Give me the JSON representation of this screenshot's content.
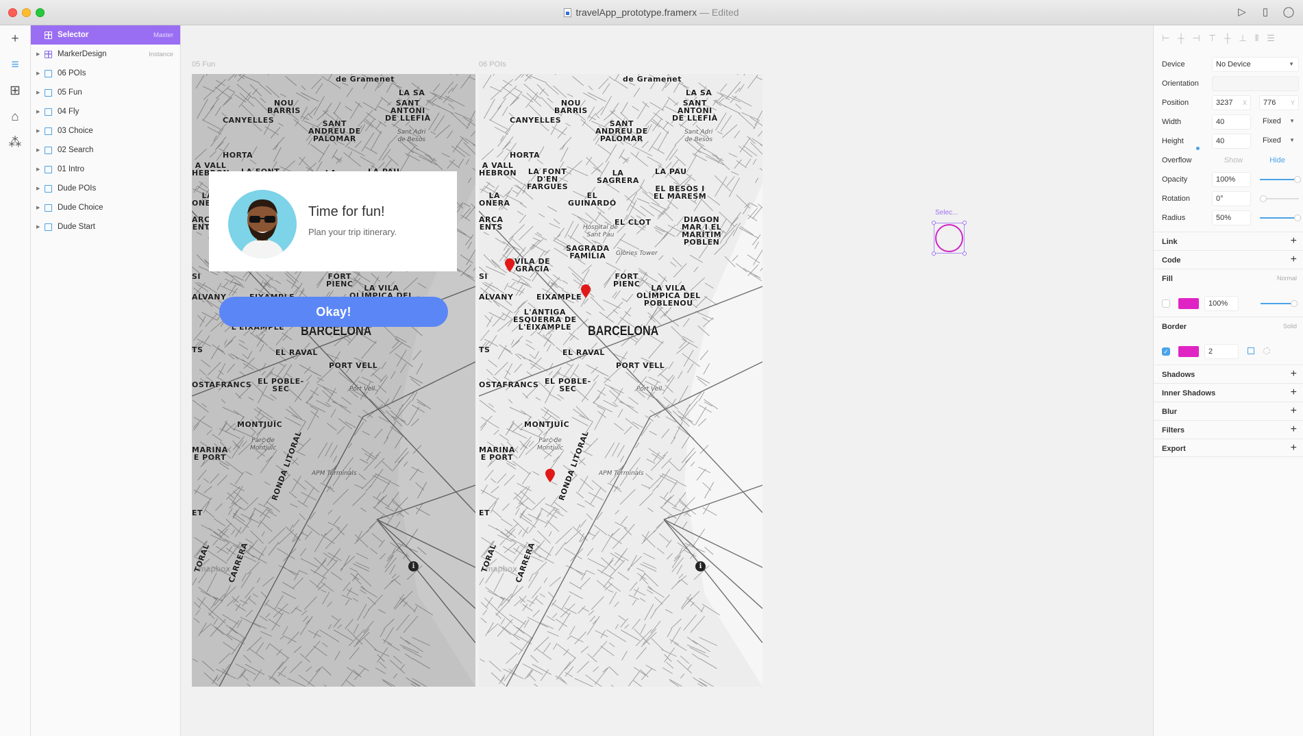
{
  "window": {
    "filename": "travelApp_prototype.framerx",
    "status": "— Edited"
  },
  "toolbar_right": {
    "icons": [
      "play-icon",
      "device-icon",
      "comment-icon"
    ]
  },
  "rail": {
    "icons": [
      "insert-icon",
      "layers-icon",
      "components-icon",
      "store-icon",
      "packages-icon"
    ]
  },
  "layers": [
    {
      "name": "Selector",
      "tag": "Master",
      "type": "component",
      "selected": true
    },
    {
      "name": "MarkerDesign",
      "tag": "Instance",
      "type": "component",
      "selected": false
    },
    {
      "name": "06 POIs",
      "tag": "",
      "type": "frame",
      "selected": false
    },
    {
      "name": "05 Fun",
      "tag": "",
      "type": "frame",
      "selected": false
    },
    {
      "name": "04 Fly",
      "tag": "",
      "type": "frame",
      "selected": false
    },
    {
      "name": "03 Choice",
      "tag": "",
      "type": "frame",
      "selected": false
    },
    {
      "name": "02 Search",
      "tag": "",
      "type": "frame",
      "selected": false
    },
    {
      "name": "01 Intro",
      "tag": "",
      "type": "frame",
      "selected": false
    },
    {
      "name": "Dude POIs",
      "tag": "",
      "type": "frame",
      "selected": false
    },
    {
      "name": "Dude Choice",
      "tag": "",
      "type": "frame",
      "selected": false
    },
    {
      "name": "Dude Start",
      "tag": "",
      "type": "frame",
      "selected": false
    }
  ],
  "canvas": {
    "frame1_label": "05 Fun",
    "frame2_label": "06 POIs",
    "selector_label": "Selec...",
    "map_labels": {
      "gramenet": "de Gramenet",
      "la_sa": "LA SA",
      "nou_barris": "NOU\nBARRIS",
      "sant_antoni": "SANT\nANTONI\nDE LLEFIÀ",
      "sant_adria": "Sant Adri\nde Besòs",
      "canyelles": "CANYELLES",
      "sant_andreu": "SANT\nANDREU DE\nPALOMAR",
      "horta": "HORTA",
      "vall_hebron": "A VALL\nHEBRON",
      "font_fargues": "LA FONT\nD'EN\nFARGUES",
      "sagrera": "LA\nSAGRERA",
      "la_pau": "LA PAU",
      "onera": "LA\nONERA",
      "guinardo": "EL\nGUINARDÓ",
      "besos": "EL BESÒS I\nEL MARESM",
      "arca": "ARCA\nENTS",
      "clot": "EL CLOT",
      "diagonal": "DIAGON\nMAR I EL\nMARÍTIM\nPOBLEN",
      "hospital": "Hospital de\nSant Pau",
      "sagrada": "SAGRADA\nFAMÍLIA",
      "glories": "Glòries Tower",
      "vila_gracia": "VILA DE\nGRÀCIA",
      "si": "SI",
      "fort_pienc": "FORT\nPIENC",
      "alvany": "ALVANY",
      "eixample": "EIXAMPLE",
      "vila_olimpica": "LA VILA\nOLÍMPICA DEL\nPOBLENOU",
      "antiga": "L'ANTIGA\nESQUERRA DE\nL'EIXAMPLE",
      "barcelona": "BARCELONA",
      "ts": "TS",
      "raval": "EL RAVAL",
      "port_vell": "PORT VELL",
      "hostafrancs": "OSTAFRANCS",
      "poble_sec": "EL POBLE-\nSEC",
      "port_vell_sm": "Port Vell",
      "montjuic": "MONTJUÏC",
      "parc": "Parc de\nMontjuïc",
      "ronda": "RONDA LITORAL",
      "marina": "MARINA\nE PORT",
      "apm": "APM Terminals",
      "et": "ET",
      "toral": "TORAL",
      "carrera": "CARRERA",
      "mapbox": "mapbox"
    },
    "card": {
      "title": "Time for fun!",
      "subtitle": "Plan your trip itinerary."
    },
    "okay_button": "Okay!"
  },
  "properties": {
    "device_label": "Device",
    "device_value": "No Device",
    "orientation_label": "Orientation",
    "position_label": "Position",
    "position_x": "3237",
    "position_x_unit": "X",
    "position_y": "776",
    "position_y_unit": "Y",
    "width_label": "Width",
    "width_value": "40",
    "width_mode": "Fixed",
    "height_label": "Height",
    "height_value": "40",
    "height_mode": "Fixed",
    "overflow_label": "Overflow",
    "overflow_show": "Show",
    "overflow_hide": "Hide",
    "opacity_label": "Opacity",
    "opacity_value": "100%",
    "rotation_label": "Rotation",
    "rotation_value": "0°",
    "radius_label": "Radius",
    "radius_value": "50%",
    "link_label": "Link",
    "code_label": "Code",
    "fill_label": "Fill",
    "fill_mode": "Normal",
    "fill_opacity": "100%",
    "fill_color": "#e024c4",
    "border_label": "Border",
    "border_mode": "Solid",
    "border_width": "2",
    "border_color": "#e024c4",
    "shadows_label": "Shadows",
    "inner_shadows_label": "Inner Shadows",
    "blur_label": "Blur",
    "filters_label": "Filters",
    "export_label": "Export"
  }
}
